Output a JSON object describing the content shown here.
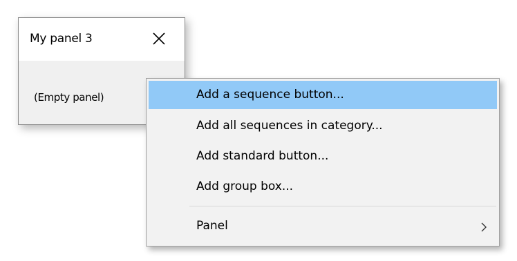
{
  "panel": {
    "title": "My panel 3",
    "body_text": "(Empty panel)",
    "close_icon": "close-icon"
  },
  "context_menu": {
    "items": [
      {
        "label": "Add a sequence button...",
        "highlighted": true
      },
      {
        "label": "Add all sequences in category..."
      },
      {
        "label": "Add standard button..."
      },
      {
        "label": "Add group box..."
      },
      {
        "label": "Panel",
        "submenu": true,
        "icon": "chevron-right-icon"
      }
    ]
  },
  "colors": {
    "highlight": "#91c9f7",
    "menu_background": "#f2f2f2",
    "panel_background": "#f0f0f0"
  }
}
